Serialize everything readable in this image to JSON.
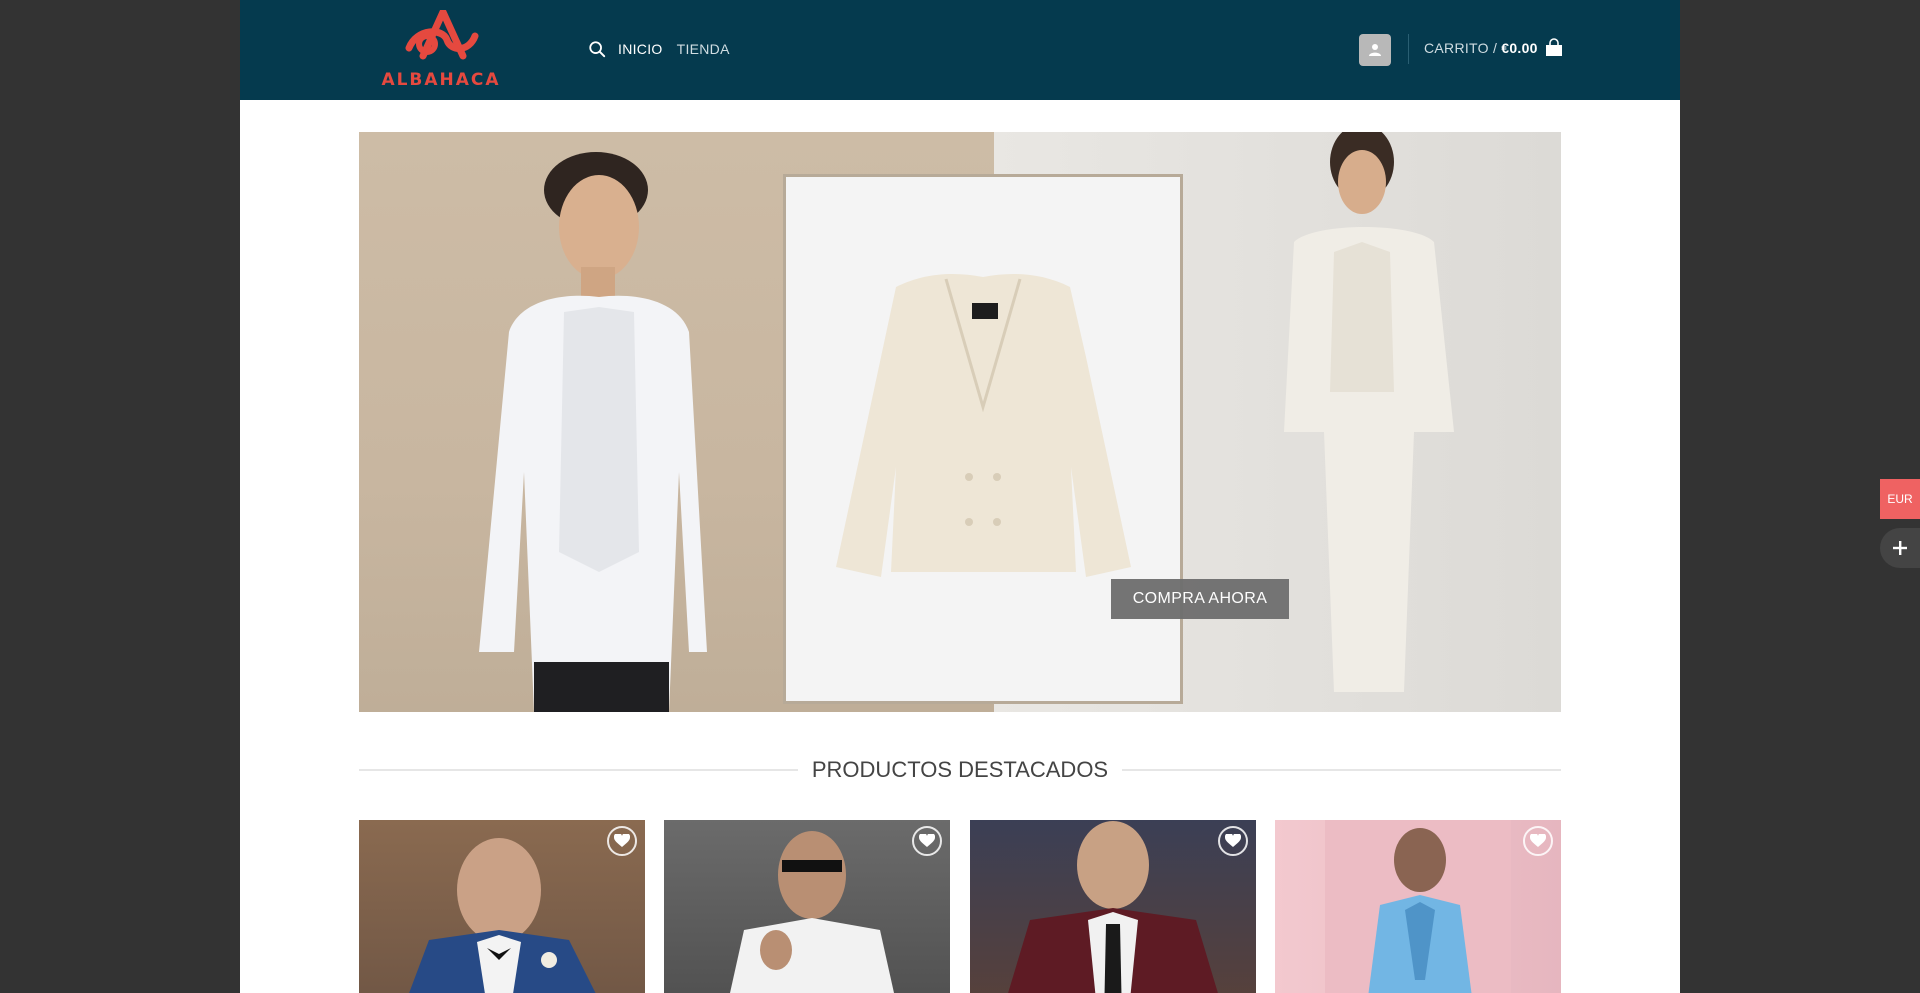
{
  "brand": {
    "name": "ALBAHACA",
    "color": "#e5493f"
  },
  "header": {
    "background": "#053a4e",
    "nav": [
      {
        "label": "INICIO"
      },
      {
        "label": "TIENDA"
      }
    ],
    "search_icon": "search-icon",
    "account_icon": "user-icon",
    "cart": {
      "label": "CARRITO /",
      "amount": "€0.00",
      "icon": "shopping-bag-icon"
    }
  },
  "hero": {
    "cta_label": "COMPRA AHORA"
  },
  "featured": {
    "title": "PRODUCTOS DESTACADOS",
    "products": [
      {
        "fav_icon": "heart-icon"
      },
      {
        "fav_icon": "heart-icon"
      },
      {
        "fav_icon": "heart-icon"
      },
      {
        "fav_icon": "heart-icon"
      }
    ]
  },
  "side": {
    "currency": "EUR",
    "plus_icon": "plus-icon"
  }
}
